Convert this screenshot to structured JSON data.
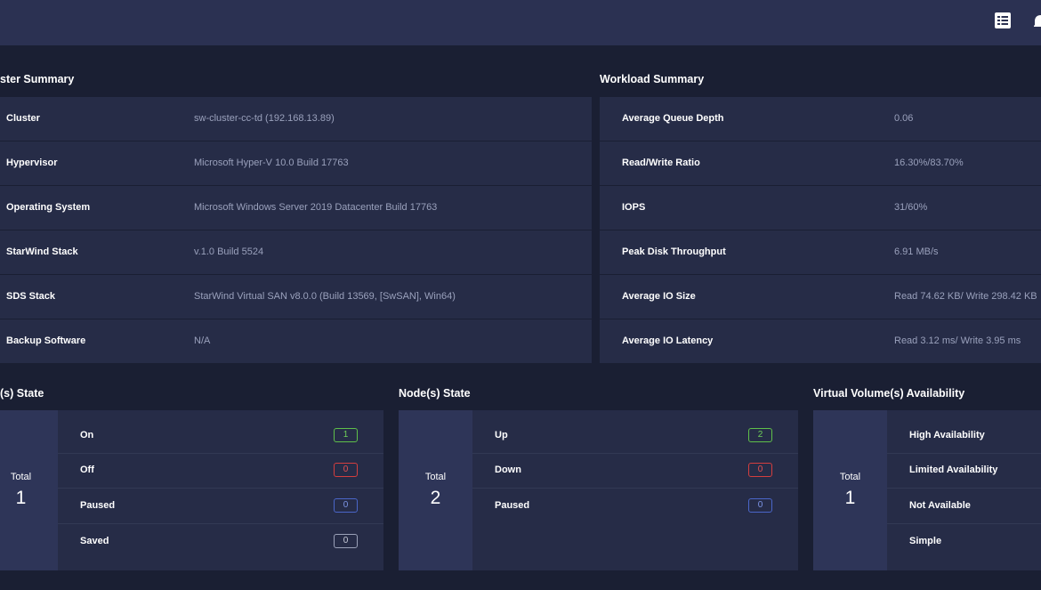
{
  "cluster_summary": {
    "title": "ster Summary",
    "rows": [
      {
        "label": "Cluster",
        "value": "sw-cluster-cc-td (192.168.13.89)"
      },
      {
        "label": "Hypervisor",
        "value": "Microsoft Hyper-V 10.0 Build 17763"
      },
      {
        "label": "Operating System",
        "value": "Microsoft Windows Server 2019 Datacenter Build 17763"
      },
      {
        "label": "StarWind Stack",
        "value": "v.1.0 Build 5524"
      },
      {
        "label": "SDS Stack",
        "value": "StarWind Virtual SAN v8.0.0 (Build 13569, [SwSAN], Win64)"
      },
      {
        "label": "Backup Software",
        "value": "N/A"
      }
    ]
  },
  "workload_summary": {
    "title": "Workload Summary",
    "rows": [
      {
        "label": "Average Queue Depth",
        "value": "0.06"
      },
      {
        "label": "Read/Write Ratio",
        "value": "16.30%/83.70%"
      },
      {
        "label": "IOPS",
        "value": "31/60%"
      },
      {
        "label": "Peak Disk Throughput",
        "value": "6.91 MB/s"
      },
      {
        "label": "Average IO Size",
        "value": "Read 74.62 KB/ Write 298.42 KB"
      },
      {
        "label": "Average IO Latency",
        "value": "Read 3.12 ms/ Write 3.95 ms"
      }
    ]
  },
  "vm_state": {
    "title": "(s) State",
    "total_label": "Total",
    "total": "1",
    "rows": [
      {
        "label": "On",
        "count": "1",
        "color": "#5fbf4a"
      },
      {
        "label": "Off",
        "count": "0",
        "color": "#d43e3e"
      },
      {
        "label": "Paused",
        "count": "0",
        "color": "#4a66c9"
      },
      {
        "label": "Saved",
        "count": "0",
        "color": "#9aa1b8"
      }
    ]
  },
  "node_state": {
    "title": "Node(s) State",
    "total_label": "Total",
    "total": "2",
    "rows": [
      {
        "label": "Up",
        "count": "2",
        "color": "#5fbf4a"
      },
      {
        "label": "Down",
        "count": "0",
        "color": "#d43e3e"
      },
      {
        "label": "Paused",
        "count": "0",
        "color": "#4a66c9"
      }
    ]
  },
  "volume_availability": {
    "title": "Virtual Volume(s) Availability",
    "total_label": "Total",
    "total": "1",
    "rows": [
      {
        "label": "High Availability"
      },
      {
        "label": "Limited Availability"
      },
      {
        "label": "Not Available"
      },
      {
        "label": "Simple"
      }
    ]
  },
  "icons": {
    "checklist": "checklist-icon",
    "notifications": "bell-icon"
  },
  "colors": {
    "background": "#1a1f33",
    "topbar": "#2b3152",
    "panel": "#262c47",
    "total_panel": "#2e3558"
  }
}
